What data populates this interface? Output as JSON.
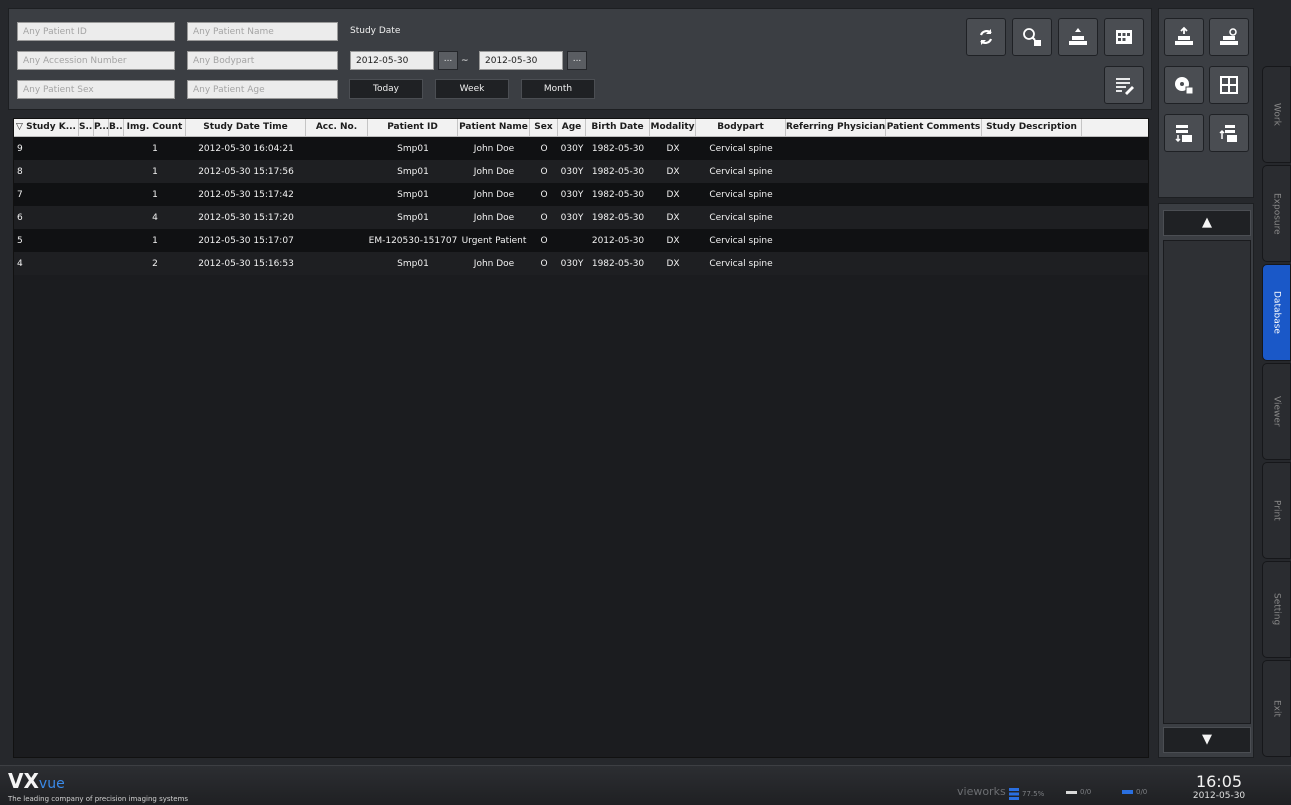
{
  "search": {
    "patient_id_placeholder": "Any Patient ID",
    "patient_name_placeholder": "Any Patient Name",
    "accession_placeholder": "Any Accession Number",
    "bodypart_placeholder": "Any Bodypart",
    "sex_placeholder": "Any Patient Sex",
    "age_placeholder": "Any Patient Age",
    "study_date_label": "Study Date",
    "date_from": "2012-05-30",
    "date_to": "2012-05-30",
    "dots": "...",
    "tilde": "~",
    "today_label": "Today",
    "week_label": "Week",
    "month_label": "Month"
  },
  "toolbar": {
    "icons": [
      "refresh-icon",
      "search-delete-icon",
      "import-icon",
      "media-icon",
      "notes-edit-icon"
    ]
  },
  "right_tools": {
    "icons": [
      "send-icon",
      "burn-icon",
      "cd-export-icon",
      "layout-icon",
      "transfer-icon",
      "receive-icon"
    ]
  },
  "table": {
    "columns": [
      "▽ Study K...",
      "S...",
      "P...",
      "B...",
      "Img. Count",
      "Study Date Time",
      "Acc. No.",
      "Patient ID",
      "Patient Name",
      "Sex",
      "Age",
      "Birth Date",
      "Modality",
      "Bodypart",
      "Referring Physician",
      "Patient Comments",
      "Study Description"
    ],
    "rows": [
      [
        "9",
        "",
        "",
        "",
        "1",
        "2012-05-30 16:04:21",
        "",
        "Smp01",
        "John Doe",
        "O",
        "030Y",
        "1982-05-30",
        "DX",
        "Cervical spine",
        "",
        "",
        ""
      ],
      [
        "8",
        "",
        "",
        "",
        "1",
        "2012-05-30 15:17:56",
        "",
        "Smp01",
        "John Doe",
        "O",
        "030Y",
        "1982-05-30",
        "DX",
        "Cervical spine",
        "",
        "",
        ""
      ],
      [
        "7",
        "",
        "",
        "",
        "1",
        "2012-05-30 15:17:42",
        "",
        "Smp01",
        "John Doe",
        "O",
        "030Y",
        "1982-05-30",
        "DX",
        "Cervical spine",
        "",
        "",
        ""
      ],
      [
        "6",
        "",
        "",
        "",
        "4",
        "2012-05-30 15:17:20",
        "",
        "Smp01",
        "John Doe",
        "O",
        "030Y",
        "1982-05-30",
        "DX",
        "Cervical spine",
        "",
        "",
        ""
      ],
      [
        "5",
        "",
        "",
        "",
        "1",
        "2012-05-30 15:17:07",
        "",
        "EM-120530-151707",
        "Urgent Patient",
        "O",
        "",
        "2012-05-30",
        "DX",
        "Cervical spine",
        "",
        "",
        ""
      ],
      [
        "4",
        "",
        "",
        "",
        "2",
        "2012-05-30 15:16:53",
        "",
        "Smp01",
        "John Doe",
        "O",
        "030Y",
        "1982-05-30",
        "DX",
        "Cervical spine",
        "",
        "",
        ""
      ]
    ]
  },
  "scroll": {
    "up": "▲",
    "down": "▼"
  },
  "tabs": [
    {
      "label": "Work",
      "active": false
    },
    {
      "label": "Exposure",
      "active": false
    },
    {
      "label": "Database",
      "active": true
    },
    {
      "label": "Viewer",
      "active": false
    },
    {
      "label": "Print",
      "active": false
    },
    {
      "label": "Setting",
      "active": false
    },
    {
      "label": "Exit",
      "active": false
    }
  ],
  "footer": {
    "logo_main": "VX",
    "logo_sub": "vue",
    "tagline": "The leading company of precision imaging systems",
    "brand": "vieworks",
    "disk_usage": "77.5%",
    "queue_1": "0/0",
    "queue_2": "0/0",
    "time": "16:05",
    "date": "2012-05-30"
  },
  "colors": {
    "accent": "#1a58c8",
    "panel": "#3b3e43",
    "table_bg": "#1b1c1f"
  }
}
